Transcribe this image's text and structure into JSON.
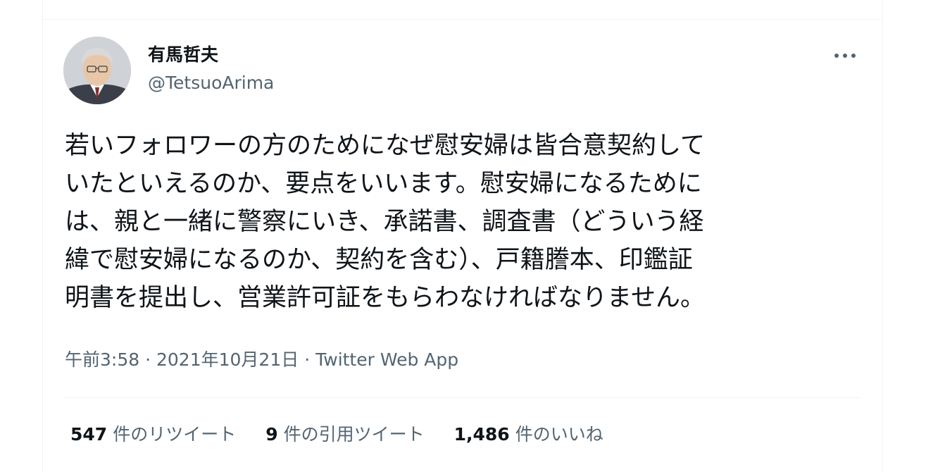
{
  "author": {
    "name": "有馬哲夫",
    "handle": "@TetsuoArima"
  },
  "tweet": {
    "lines": [
      "若いフォロワーの方のためになぜ慰安婦は皆合意契約して",
      "いたといえるのか、要点をいいます。慰安婦になるために",
      "は、親と一緒に警察にいき、承諾書、調査書（どういう経",
      "緯で慰安婦になるのか、契約を含む）、戸籍謄本、印鑑証",
      "明書を提出し、営業許可証をもらわなければなりません。"
    ]
  },
  "meta": {
    "time": "午前3:58",
    "date": "2021年10月21日",
    "source": "Twitter Web App",
    "separator": "·"
  },
  "stats": {
    "retweets": {
      "count": "547",
      "label": "件のリツイート"
    },
    "quotes": {
      "count": "9",
      "label": "件の引用ツイート"
    },
    "likes": {
      "count": "1,486",
      "label": "件のいいね"
    }
  },
  "icons": {
    "more": "more-horizontal-icon"
  },
  "colors": {
    "text": "#0f1419",
    "secondary": "#536471",
    "divider": "#eff3f4"
  }
}
